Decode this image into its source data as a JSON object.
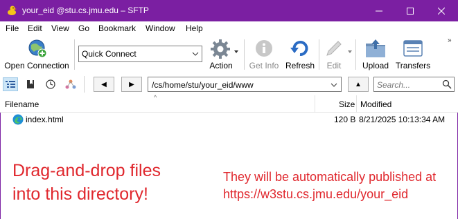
{
  "window": {
    "title": "your_eid @stu.cs.jmu.edu – SFTP",
    "titlebar_color": "#7b1fa2"
  },
  "menu": [
    "File",
    "Edit",
    "View",
    "Go",
    "Bookmark",
    "Window",
    "Help"
  ],
  "toolbar": {
    "open_connection": "Open Connection",
    "quick_connect": "Quick Connect",
    "action": "Action",
    "get_info": "Get Info",
    "refresh": "Refresh",
    "edit": "Edit",
    "upload": "Upload",
    "transfers": "Transfers"
  },
  "navbar": {
    "back": "◀",
    "forward": "▶",
    "path": "/cs/home/stu/your_eid/www",
    "up": "▲",
    "search_placeholder": "Search..."
  },
  "columns": {
    "filename": "Filename",
    "size": "Size",
    "modified": "Modified"
  },
  "files": [
    {
      "name": "index.html",
      "size": "120 B",
      "modified": "8/21/2025 10:13:34 AM",
      "icon": "edge-html-icon"
    }
  ],
  "annotations": {
    "left_line1": "Drag-and-drop files",
    "left_line2": "into this directory!",
    "right_line1": "They will be automatically published at",
    "right_line2": "https://w3stu.cs.jmu.edu/your_eid",
    "color": "#e0282e"
  }
}
